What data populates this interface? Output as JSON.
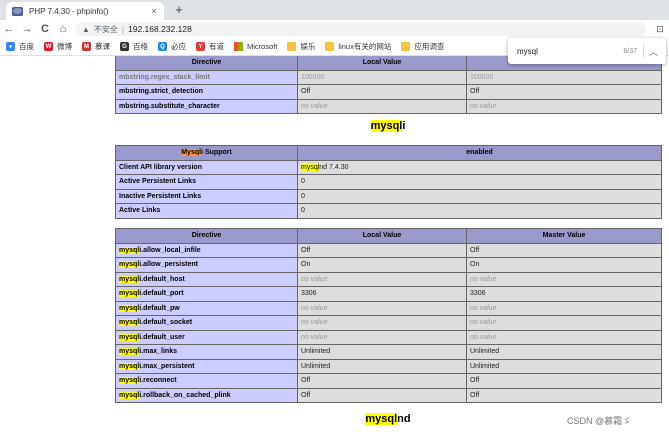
{
  "browser": {
    "tab_title": "PHP 7.4.30 - phpinfo()",
    "tab_close": "×",
    "new_tab": "+",
    "back": "←",
    "forward": "→",
    "reload": "C",
    "home": "⌂",
    "security_warning": "▲",
    "insecure_label": "不安全",
    "separator": "|",
    "url": "192.168.232.128",
    "ext_icon": "⊡"
  },
  "bookmarks": [
    {
      "label": "百度",
      "color": "#3385ff",
      "glyph": "●"
    },
    {
      "label": "微博",
      "color": "#e6162d",
      "glyph": "W"
    },
    {
      "label": "慕课",
      "color": "#d32f2f",
      "glyph": "M"
    },
    {
      "label": "百络",
      "color": "#333333",
      "glyph": "G"
    },
    {
      "label": "必应",
      "color": "#1e88e5",
      "glyph": "Q"
    },
    {
      "label": "有道",
      "color": "#e53935",
      "glyph": "Y"
    },
    {
      "label": "Microsoft",
      "color": "ms",
      "glyph": ""
    },
    {
      "label": "娱乐",
      "color": "#f6c343",
      "glyph": ""
    },
    {
      "label": "linux有关的网站",
      "color": "#f6c343",
      "glyph": ""
    },
    {
      "label": "应用调查",
      "color": "#f6c343",
      "glyph": ""
    }
  ],
  "find": {
    "query": "mysql",
    "count": "6/37",
    "up": "︿"
  },
  "mbstring": {
    "header": [
      "Directive",
      "Local Value",
      "Master Value"
    ],
    "rows": [
      {
        "name": "mbstring.regex_stack_limit",
        "local": "100000",
        "master": "100000",
        "nv": false
      },
      {
        "name": "mbstring.strict_detection",
        "local": "Off",
        "master": "Off",
        "nv": false
      },
      {
        "name": "mbstring.substitute_character",
        "local": "no value",
        "master": "no value",
        "nv": true
      }
    ]
  },
  "mysqli": {
    "heading_hl": "mysql",
    "heading_rest": "i",
    "support": {
      "name_hl": "Mysql",
      "name_rest": "i Support",
      "value": "enabled"
    },
    "info_rows": [
      {
        "name": "Client API library version",
        "value_hl": "mysql",
        "value_rest": "nd 7.4.30"
      },
      {
        "name": "Active Persistent Links",
        "value": "0"
      },
      {
        "name": "Inactive Persistent Links",
        "value": "0"
      },
      {
        "name": "Active Links",
        "value": "0"
      }
    ],
    "directive_header": [
      "Directive",
      "Local Value",
      "Master Value"
    ],
    "directives": [
      {
        "name_hl": "mysql",
        "name_rest": "i.allow_local_infile",
        "local": "Off",
        "master": "Off",
        "nv": false
      },
      {
        "name_hl": "mysql",
        "name_rest": "i.allow_persistent",
        "local": "On",
        "master": "On",
        "nv": false
      },
      {
        "name_hl": "mysql",
        "name_rest": "i.default_host",
        "local": "no value",
        "master": "no value",
        "nv": true
      },
      {
        "name_hl": "mysql",
        "name_rest": "i.default_port",
        "local": "3306",
        "master": "3306",
        "nv": false
      },
      {
        "name_hl": "mysql",
        "name_rest": "i.default_pw",
        "local": "no value",
        "master": "no value",
        "nv": true
      },
      {
        "name_hl": "mysql",
        "name_rest": "i.default_socket",
        "local": "no value",
        "master": "no value",
        "nv": true
      },
      {
        "name_hl": "mysql",
        "name_rest": "i.default_user",
        "local": "no value",
        "master": "no value",
        "nv": true
      },
      {
        "name_hl": "mysql",
        "name_rest": "i.max_links",
        "local": "Unlimited",
        "master": "Unlimited",
        "nv": false
      },
      {
        "name_hl": "mysql",
        "name_rest": "i.max_persistent",
        "local": "Unlimited",
        "master": "Unlimited",
        "nv": false
      },
      {
        "name_hl": "mysql",
        "name_rest": "i.reconnect",
        "local": "Off",
        "master": "Off",
        "nv": false
      },
      {
        "name_hl": "mysql",
        "name_rest": "i.rollback_on_cached_plink",
        "local": "Off",
        "master": "Off",
        "nv": false
      }
    ]
  },
  "mysqlnd": {
    "heading_hl": "mysql",
    "heading_rest": "nd"
  },
  "watermark": "CSDN @慕霜ゞ"
}
